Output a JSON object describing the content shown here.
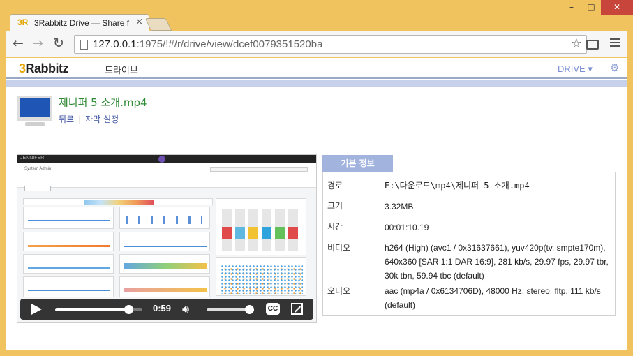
{
  "browser": {
    "tab_title": "3Rabbitz Drive — Share f",
    "tab_logo": "3R",
    "url_host": "127.0.0.1",
    "url_rest": ":1975/!#/r/drive/view/dcef0079351520ba",
    "icons": {
      "back": "←",
      "forward": "→",
      "reload": "↻",
      "star": "☆",
      "close_tab": "×",
      "minimize": "–",
      "maximize": "□",
      "close": "✕"
    }
  },
  "app": {
    "brand_three": "3",
    "brand_rest": "Rabbitz",
    "nav_drive": "드라이브",
    "drive_menu": "DRIVE ▾",
    "gear": "⚙"
  },
  "file": {
    "name": "제니퍼 5 소개.mp4",
    "back_link": "뒤로",
    "subtitle_link": "자막 설정"
  },
  "player": {
    "time": "0:59",
    "progress": 0.84,
    "volume": 0.9,
    "cc_label": "CC",
    "preview_brand": "JENNIFER",
    "preview_title": "System Admin"
  },
  "info": {
    "tab_label": "기본 정보",
    "rows": [
      {
        "key": "경로",
        "value": "E:\\다운로드\\mp4\\제니퍼 5 소개.mp4"
      },
      {
        "key": "크기",
        "value": "3.32MB"
      },
      {
        "key": "시간",
        "value": "00:01:10.19"
      },
      {
        "key": "비디오",
        "value": "h264 (High) (avc1 / 0x31637661), yuv420p(tv, smpte170m), 640x360 [SAR 1:1 DAR 16:9], 281 kb/s, 29.97 fps, 29.97 tbr, 30k tbn, 59.94 tbc (default)"
      },
      {
        "key": "오디오",
        "value": "aac (mp4a / 0x6134706D), 48000 Hz, stereo, fltp, 111 kb/s (default)"
      }
    ]
  }
}
